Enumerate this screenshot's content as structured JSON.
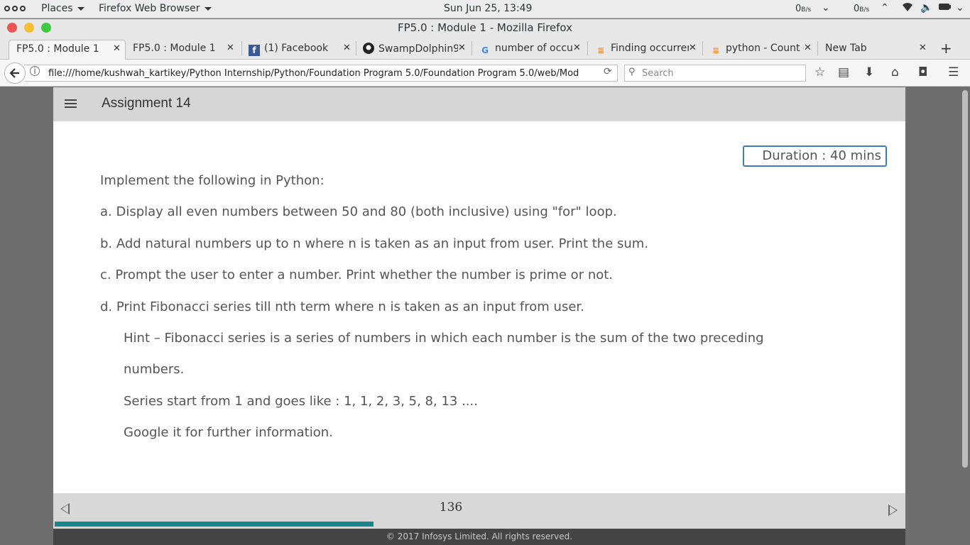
{
  "system_bar": {
    "places_label": "Places",
    "app_label": "Firefox Web Browser",
    "clock": "Sun Jun 25, 13:49",
    "net_down": "0",
    "net_up": "0",
    "net_unit": "B/s"
  },
  "window": {
    "title": "FP5.0 : Module 1 - Mozilla Firefox"
  },
  "tabs": [
    {
      "label": "FP5.0 : Module 1",
      "icon": "none",
      "active": true
    },
    {
      "label": "FP5.0 : Module 1",
      "icon": "none",
      "active": false
    },
    {
      "label": "(1) Facebook",
      "icon": "facebook-icon",
      "active": false
    },
    {
      "label": "SwampDolphin9",
      "icon": "github-icon",
      "active": false
    },
    {
      "label": "number of occur",
      "icon": "google-icon",
      "active": false
    },
    {
      "label": "Finding occurren",
      "icon": "stackoverflow-icon",
      "active": false
    },
    {
      "label": "python - Count o",
      "icon": "stackoverflow-icon",
      "active": false
    },
    {
      "label": "New Tab",
      "icon": "none",
      "active": false
    }
  ],
  "navbar": {
    "url": "file:///home/kushwah_kartikey/Python Internship/Python/Foundation Program 5.0/Foundation Program 5.0/web/Mod",
    "search_placeholder": "Search"
  },
  "page": {
    "title": "Assignment 14",
    "duration": "Duration : 40 mins",
    "intro": "Implement the following in Python:",
    "items": [
      "a.  Display all even numbers between 50 and 80 (both inclusive) using \"for\" loop.",
      "b.  Add natural numbers up to n where n is taken as an input from user. Print the sum.",
      "c.  Prompt the user to enter a number. Print whether the number is prime or not.",
      "d.  Print Fibonacci series till nth term where n is taken as an input from user."
    ],
    "hint_lines": [
      "Hint – Fibonacci series is a series of numbers in which each number is the sum of the two preceding",
      "numbers.",
      "Series start from 1 and goes like : 1, 1, 2, 3, 5, 8, 13 ....",
      "Google it for further information."
    ],
    "page_number": "136",
    "progress_fraction": 0.375,
    "copyright": "© 2017 Infosys Limited. All rights reserved."
  },
  "colors": {
    "accent": "#16868a",
    "duration_border": "#3b7fb6",
    "close_dot": "#ee5451",
    "minimize_dot": "#f5bf2f",
    "maximize_dot": "#3fc93f"
  }
}
